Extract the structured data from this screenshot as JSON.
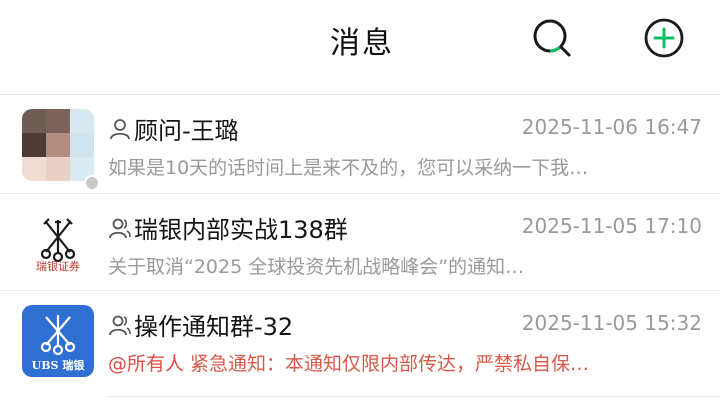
{
  "header": {
    "title": "消息",
    "search_icon": "search-icon",
    "add_icon": "plus-circle-icon",
    "accent_color": "#07c160"
  },
  "conversations": [
    {
      "name": "顾问-王璐",
      "time": "2025-11-06 16:47",
      "preview": "如果是10天的话时间上是来不及的，您可以采纳一下我…",
      "avatar": "blurred-photo"
    },
    {
      "name": "瑞银内部实战138群",
      "time": "2025-11-05 17:10",
      "preview": "关于取消“2025 全球投资先机战略峰会”的通知…",
      "avatar": "ubs-keys-logo",
      "avatar_caption": "瑞银证券"
    },
    {
      "name": "操作通知群-32",
      "time": "2025-11-05 15:32",
      "preview_mention": "@所有人",
      "preview": " 紧急通知：本通知仅限内部传达，严禁私自保…",
      "avatar": "ubs-blue-logo",
      "avatar_caption": "UBS 瑞银"
    }
  ]
}
